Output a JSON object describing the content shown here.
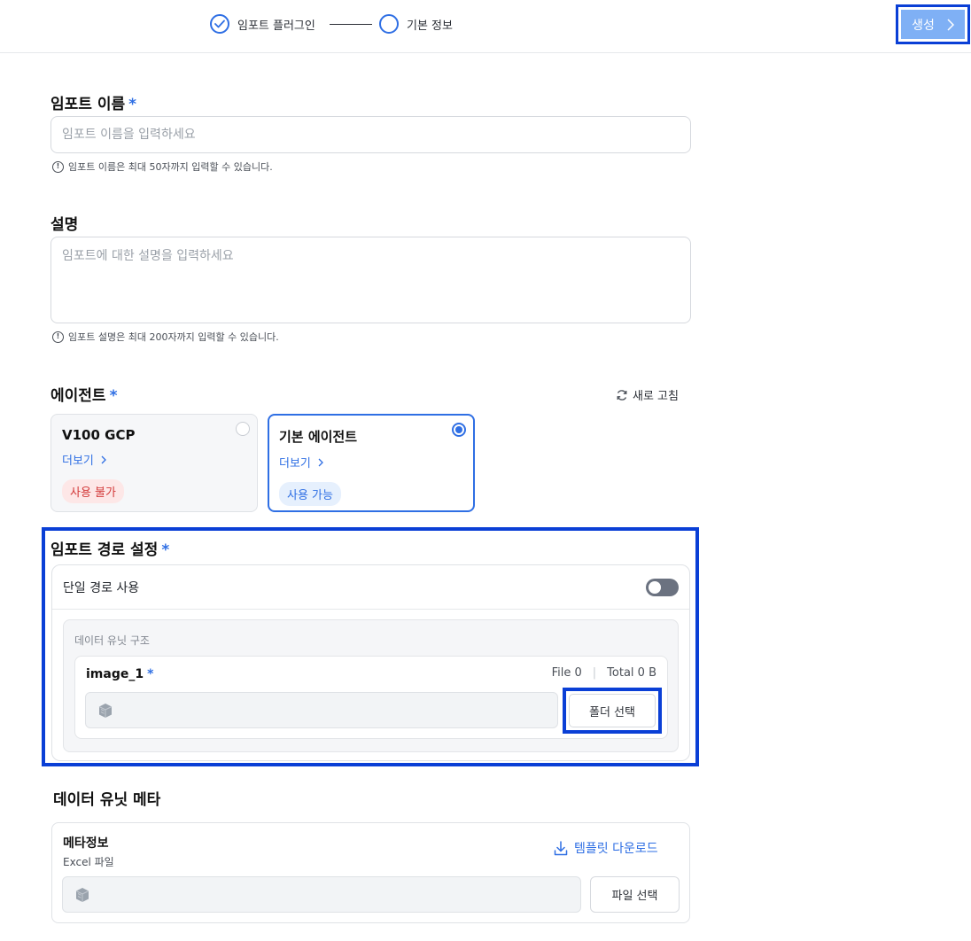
{
  "stepper": {
    "steps": [
      {
        "label": "임포트 플러그인",
        "state": "done"
      },
      {
        "label": "기본 정보",
        "state": "current"
      }
    ]
  },
  "header": {
    "create_label": "생성"
  },
  "form": {
    "name": {
      "label": "임포트 이름",
      "required_mark": "*",
      "placeholder": "임포트 이름을 입력하세요",
      "hint": "임포트 이름은 최대 50자까지 입력할 수 있습니다."
    },
    "description": {
      "label": "설명",
      "placeholder": "임포트에 대한 설명을 입력하세요",
      "hint": "임포트 설명은 최대 200자까지 입력할 수 있습니다."
    },
    "agent": {
      "label": "에이전트",
      "required_mark": "*",
      "refresh_label": "새로 고침",
      "cards": [
        {
          "name": "V100 GCP",
          "more": "더보기",
          "badge": "사용 불가",
          "status": "unavailable",
          "selected": false
        },
        {
          "name": "기본 에이전트",
          "more": "더보기",
          "badge": "사용 가능",
          "status": "available",
          "selected": true
        }
      ]
    },
    "path": {
      "label": "임포트 경로 설정",
      "required_mark": "*",
      "single_path_label": "단일 경로 사용",
      "single_path_enabled": false,
      "unit_structure_title": "데이터 유닛 구조",
      "unit": {
        "name": "image_1",
        "required_mark": "*",
        "file_stat": "File 0",
        "total_stat": "Total 0 B",
        "folder_button": "폴더 선택",
        "field_icon": "storage-icon"
      }
    },
    "meta": {
      "section_title": "데이터 유닛 메타",
      "name": "메타정보",
      "sub": "Excel 파일",
      "template_download": "템플릿 다운로드",
      "file_button": "파일 선택",
      "field_icon": "storage-icon"
    }
  },
  "colors": {
    "accent": "#2f6fe4",
    "highlight": "#0a3fd6",
    "create_button": "#7fb0f5",
    "badge_red_text": "#d33a3a",
    "badge_blue_text": "#2f6fe4"
  }
}
